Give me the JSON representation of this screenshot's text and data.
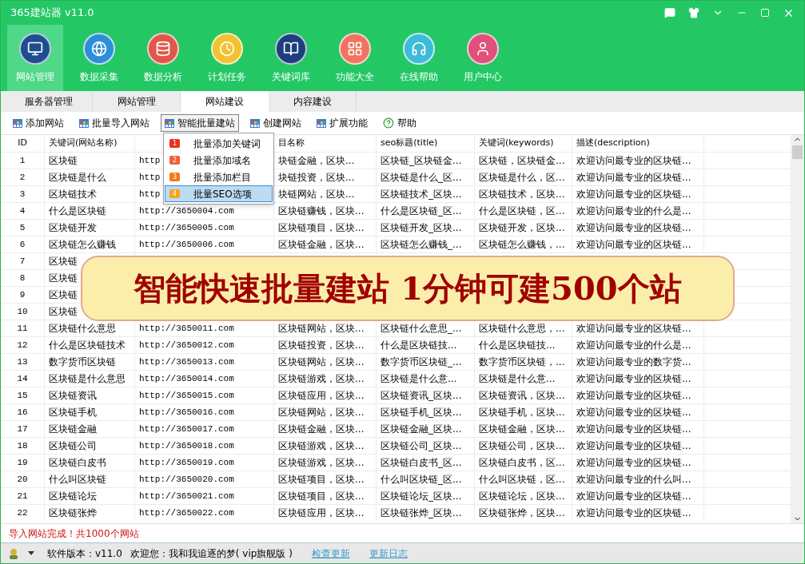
{
  "window": {
    "title": "365建站器 v11.0"
  },
  "nav": [
    {
      "label": "网站管理",
      "selected": true
    },
    {
      "label": "数据采集",
      "selected": false
    },
    {
      "label": "数据分析",
      "selected": false
    },
    {
      "label": "计划任务",
      "selected": false
    },
    {
      "label": "关键词库",
      "selected": false
    },
    {
      "label": "功能大全",
      "selected": false
    },
    {
      "label": "在线帮助",
      "selected": false
    },
    {
      "label": "用户中心",
      "selected": false
    }
  ],
  "subtabs": [
    {
      "label": "服务器管理",
      "selected": false
    },
    {
      "label": "网站管理",
      "selected": false
    },
    {
      "label": "网站建设",
      "selected": true
    },
    {
      "label": "内容建设",
      "selected": false
    }
  ],
  "toolbar": [
    {
      "label": "添加网站",
      "kind": "grid",
      "expanded": false
    },
    {
      "label": "批量导入网站",
      "kind": "grid",
      "expanded": false
    },
    {
      "label": "智能批量建站",
      "kind": "grid",
      "expanded": true
    },
    {
      "label": "创建网站",
      "kind": "grid",
      "expanded": false
    },
    {
      "label": "扩展功能",
      "kind": "grid",
      "expanded": false
    },
    {
      "label": "帮助",
      "kind": "help",
      "expanded": false
    }
  ],
  "menu": [
    {
      "badge": "1",
      "label": "批量添加关键词",
      "color": "#e8321e",
      "selected": false
    },
    {
      "badge": "2",
      "label": "批量添加域名",
      "color": "#f0603a",
      "selected": false
    },
    {
      "badge": "3",
      "label": "批量添加栏目",
      "color": "#f27a1a",
      "selected": false
    },
    {
      "badge": "4",
      "label": "批量SEO选项",
      "color": "#f7a21e",
      "selected": true
    }
  ],
  "table": {
    "columns": [
      {
        "label": "ID"
      },
      {
        "label": "关键词(网站名称)"
      },
      {},
      {
        "label": "目名称"
      },
      {
        "label": "seo标题(title)"
      },
      {
        "label": "关键词(keywords)"
      },
      {
        "label": "描述(description)"
      }
    ],
    "rows": [
      [
        "1",
        "区块链",
        "http",
        "块链金融，区块...",
        "区块链_区块链金...",
        "区块链，区块链金...",
        "欢迎访问最专业的区块链..."
      ],
      [
        "2",
        "区块链是什么",
        "http",
        "块链投资，区块...",
        "区块链是什么_区...",
        "区块链是什么，区...",
        "欢迎访问最专业的区块链..."
      ],
      [
        "3",
        "区块链技术",
        "http",
        "块链网站，区块...",
        "区块链技术_区块...",
        "区块链技术，区块...",
        "欢迎访问最专业的区块链..."
      ],
      [
        "4",
        "什么是区块链",
        "http://3650004.com",
        "区块链赚钱，区块...",
        "什么是区块链_区...",
        "什么是区块链，区...",
        "欢迎访问最专业的什么是..."
      ],
      [
        "5",
        "区块链开发",
        "http://3650005.com",
        "区块链项目，区块...",
        "区块链开发_区块...",
        "区块链开发，区块...",
        "欢迎访问最专业的区块链..."
      ],
      [
        "6",
        "区块链怎么赚钱",
        "http://3650006.com",
        "区块链金融，区块...",
        "区块链怎么赚钱_...",
        "区块链怎么赚钱，...",
        "欢迎访问最专业的区块链..."
      ],
      [
        "7",
        "区块链"
      ],
      [
        "8",
        "区块链"
      ],
      [
        "9",
        "区块链"
      ],
      [
        "10",
        "区块链"
      ],
      [
        "11",
        "区块链什么意思",
        "http://3650011.com",
        "区块链网站，区块...",
        "区块链什么意思_...",
        "区块链什么意思，...",
        "欢迎访问最专业的区块链..."
      ],
      [
        "12",
        "什么是区块链技术",
        "http://3650012.com",
        "区块链投资，区块...",
        "什么是区块链技...",
        "什么是区块链技...",
        "欢迎访问最专业的什么是..."
      ],
      [
        "13",
        "数字货币区块链",
        "http://3650013.com",
        "区块链网站，区块...",
        "数字货币区块链_...",
        "数字货币区块链，...",
        "欢迎访问最专业的数字货..."
      ],
      [
        "14",
        "区块链是什么意思",
        "http://3650014.com",
        "区块链游戏，区块...",
        "区块链是什么意...",
        "区块链是什么意...",
        "欢迎访问最专业的区块链..."
      ],
      [
        "15",
        "区块链资讯",
        "http://3650015.com",
        "区块链应用，区块...",
        "区块链资讯_区块...",
        "区块链资讯，区块...",
        "欢迎访问最专业的区块链..."
      ],
      [
        "16",
        "区块链手机",
        "http://3650016.com",
        "区块链网站，区块...",
        "区块链手机_区块...",
        "区块链手机，区块...",
        "欢迎访问最专业的区块链..."
      ],
      [
        "17",
        "区块链金融",
        "http://3650017.com",
        "区块链金融，区块...",
        "区块链金融_区块...",
        "区块链金融，区块...",
        "欢迎访问最专业的区块链..."
      ],
      [
        "18",
        "区块链公司",
        "http://3650018.com",
        "区块链游戏，区块...",
        "区块链公司_区块...",
        "区块链公司，区块...",
        "欢迎访问最专业的区块链..."
      ],
      [
        "19",
        "区块链白皮书",
        "http://3650019.com",
        "区块链游戏，区块...",
        "区块链白皮书_区...",
        "区块链白皮书，区...",
        "欢迎访问最专业的区块链..."
      ],
      [
        "20",
        "什么叫区块链",
        "http://3650020.com",
        "区块链项目，区块...",
        "什么叫区块链_区...",
        "什么叫区块链，区...",
        "欢迎访问最专业的什么叫..."
      ],
      [
        "21",
        "区块链论坛",
        "http://3650021.com",
        "区块链项目，区块...",
        "区块链论坛_区块...",
        "区块链论坛，区块...",
        "欢迎访问最专业的区块链..."
      ],
      [
        "22",
        "区块链张烨",
        "http://3650022.com",
        "区块链应用，区块...",
        "区块链张烨_区块...",
        "区块链张烨，区块...",
        "欢迎访问最专业的区块链..."
      ]
    ]
  },
  "banner": "智能快速批量建站 1分钟可建500个站",
  "status": "导入网站完成！共1000个网站",
  "footer": {
    "version": "软件版本：v11.0",
    "welcome": "欢迎您：我和我追逐的梦( vip旗舰版 )",
    "links": [
      "检查更新",
      "更新日志"
    ]
  }
}
